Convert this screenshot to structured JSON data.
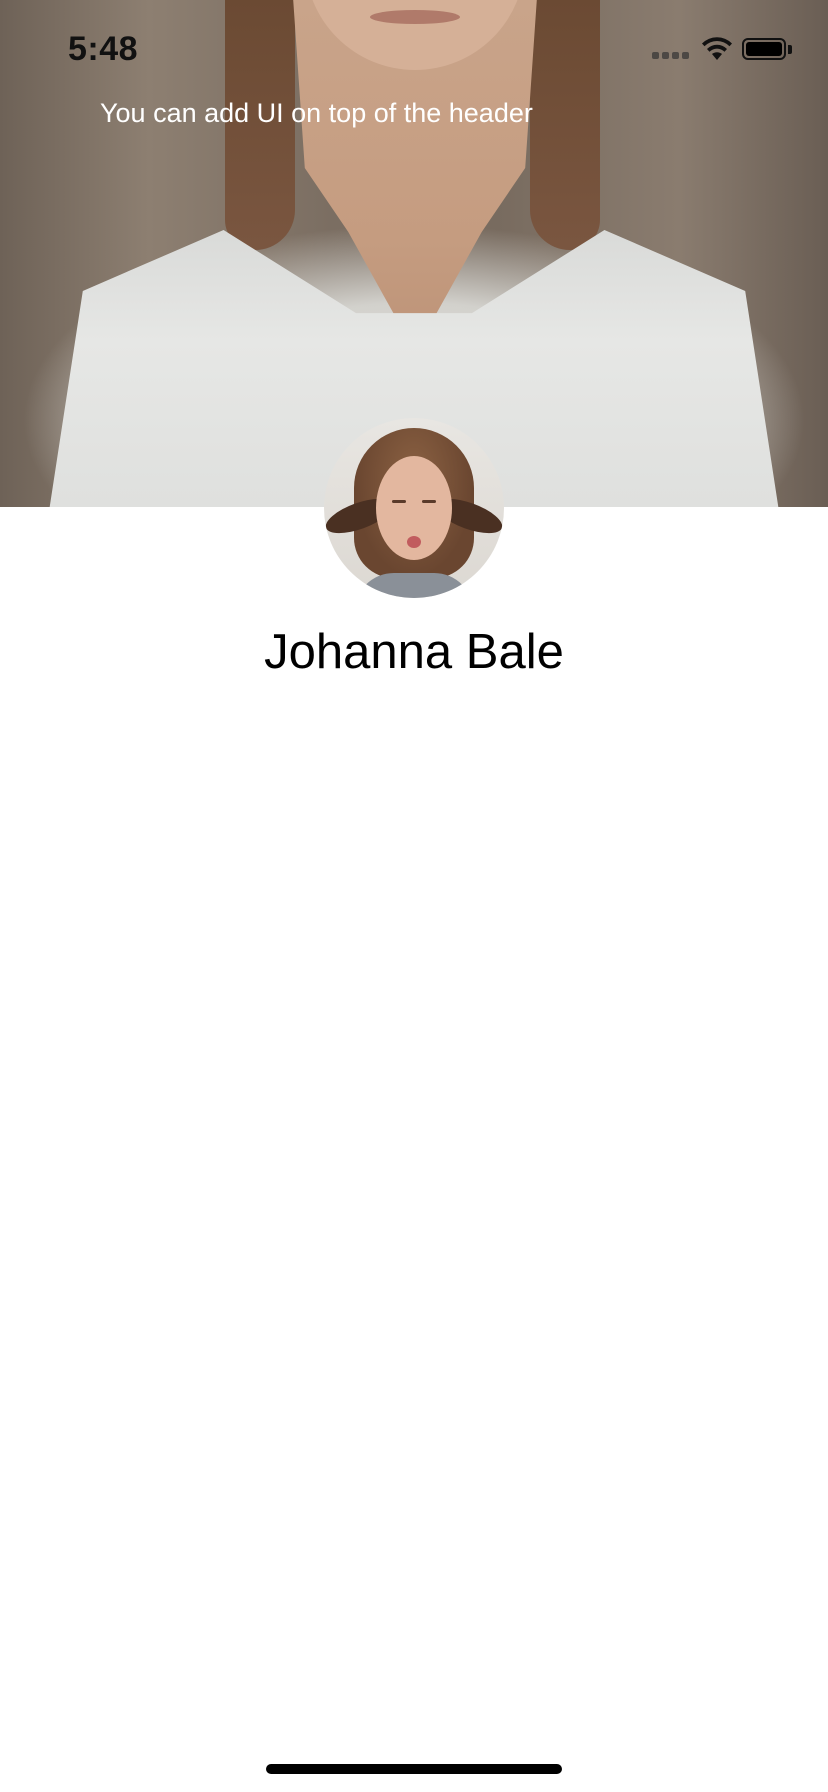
{
  "status_bar": {
    "time": "5:48",
    "signal_icon": "cellular-signal-icon",
    "wifi_icon": "wifi-icon",
    "battery_icon": "battery-icon",
    "battery_level": 1.0
  },
  "header": {
    "background_image": "woman-white-shirt-photo",
    "overlay_text": "You can add UI on top of the header"
  },
  "profile": {
    "avatar_image": "profile-avatar-photo",
    "name": "Johanna Bale"
  },
  "colors": {
    "overlay_text": "#ffffff",
    "name_text": "#000000",
    "background": "#ffffff"
  }
}
